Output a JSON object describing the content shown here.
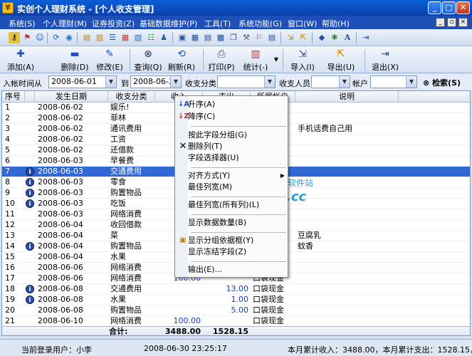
{
  "window": {
    "title": "实创个人理财系统 - [个人收支管理]",
    "app_icon": "coin-icon"
  },
  "menu": [
    {
      "label": "系统(S)"
    },
    {
      "label": "个人理财(M)"
    },
    {
      "label": "证券投资(Z)"
    },
    {
      "label": "基础数据维护(P)"
    },
    {
      "label": "工具(T)"
    },
    {
      "label": "系统功能(G)"
    },
    {
      "label": "窗口(W)"
    },
    {
      "label": "帮助(H)"
    }
  ],
  "toolbar": [
    {
      "label": "添加(A)",
      "icon": "plus-icon"
    },
    {
      "label": "删除(D)",
      "icon": "minus-icon"
    },
    {
      "label": "修改(E)",
      "icon": "pen-icon"
    },
    {
      "label": "查询(Q)",
      "icon": "binoculars-icon"
    },
    {
      "label": "刷新(R)",
      "icon": "refresh-icon"
    },
    {
      "label": "打印(P)",
      "icon": "printer-icon"
    },
    {
      "label": "统计(-)",
      "icon": "chart-icon"
    },
    {
      "label": "导入(I)",
      "icon": "import-icon"
    },
    {
      "label": "导出(U)",
      "icon": "export-icon"
    },
    {
      "label": "退出(X)",
      "icon": "exit-icon"
    }
  ],
  "filter": {
    "date_label": "入帐时间从",
    "date_from": "2008-06-01",
    "to_label": "到",
    "date_to": "2008-06-30",
    "category_label": "收支分类",
    "category_value": "",
    "person_label": "收支人员",
    "person_value": "",
    "account_label": "帐户",
    "account_value": "",
    "search_label": "检索(S)"
  },
  "columns": [
    "序号",
    "发生日期",
    "收支分类",
    "收入",
    "支出",
    "所属帐户",
    "说明"
  ],
  "rows": [
    {
      "no": "1",
      "date": "2008-06-02",
      "category": "娱乐!",
      "income": "",
      "expense": "",
      "account": "",
      "note": "",
      "info": false
    },
    {
      "no": "2",
      "date": "2008-06-02",
      "category": "菲林",
      "income": "",
      "expense": "",
      "account": "",
      "note": "",
      "info": false
    },
    {
      "no": "3",
      "date": "2008-06-02",
      "category": "通讯费用",
      "income": "",
      "expense": "",
      "account": "",
      "note": "手机话费自己用",
      "info": false
    },
    {
      "no": "4",
      "date": "2008-06-02",
      "category": "工资",
      "income": "2",
      "expense": "",
      "account": "",
      "note": "",
      "info": false
    },
    {
      "no": "5",
      "date": "2008-06-02",
      "category": "还借款",
      "income": "",
      "expense": "",
      "account": "",
      "note": "",
      "info": false
    },
    {
      "no": "6",
      "date": "2008-06-03",
      "category": "早餐费",
      "income": "",
      "expense": "",
      "account": "",
      "note": "",
      "info": false
    },
    {
      "no": "7",
      "date": "2008-06-03",
      "category": "交通费用",
      "income": "",
      "expense": "",
      "account": "",
      "note": "",
      "info": true
    },
    {
      "no": "8",
      "date": "2008-06-03",
      "category": "零食",
      "income": "",
      "expense": "",
      "account": "",
      "note": "",
      "info": true
    },
    {
      "no": "9",
      "date": "2008-06-03",
      "category": "购置物品",
      "income": "",
      "expense": "",
      "account": "",
      "note": "",
      "info": true
    },
    {
      "no": "10",
      "date": "2008-06-03",
      "category": "吃饭",
      "income": "",
      "expense": "",
      "account": "",
      "note": "",
      "info": true
    },
    {
      "no": "11",
      "date": "2008-06-03",
      "category": "网络消费",
      "income": "",
      "expense": "",
      "account": "",
      "note": "",
      "info": false
    },
    {
      "no": "12",
      "date": "2008-06-04",
      "category": "收回借款",
      "income": "",
      "expense": "",
      "account": "",
      "note": "",
      "info": false
    },
    {
      "no": "13",
      "date": "2008-06-04",
      "category": "菜",
      "income": "",
      "expense": "",
      "account": "",
      "note": "豆腐乳",
      "info": false
    },
    {
      "no": "14",
      "date": "2008-06-04",
      "category": "购置物品",
      "income": "",
      "expense": "",
      "account": "",
      "note": "蚊香",
      "info": true
    },
    {
      "no": "15",
      "date": "2008-06-04",
      "category": "水果",
      "income": "",
      "expense": "",
      "account": "",
      "note": "",
      "info": false
    },
    {
      "no": "16",
      "date": "2008-06-06",
      "category": "网络消费",
      "income": "",
      "expense": "",
      "account": "",
      "note": "",
      "info": false
    },
    {
      "no": "17",
      "date": "2008-06-06",
      "category": "网络消费",
      "income": "100.00",
      "expense": "",
      "account": "口袋现金",
      "note": "",
      "info": false
    },
    {
      "no": "18",
      "date": "2008-06-08",
      "category": "交通费用",
      "income": "",
      "expense": "13.00",
      "account": "口袋现金",
      "note": "",
      "info": true
    },
    {
      "no": "19",
      "date": "2008-06-08",
      "category": "水果",
      "income": "",
      "expense": "1.00",
      "account": "口袋现金",
      "note": "",
      "info": true
    },
    {
      "no": "20",
      "date": "2008-06-08",
      "category": "购置物品",
      "income": "",
      "expense": "5.00",
      "account": "口袋现金",
      "note": "",
      "info": false
    },
    {
      "no": "21",
      "date": "2008-06-10",
      "category": "网络消费",
      "income": "100.00",
      "expense": "",
      "account": "口袋现金",
      "note": "",
      "info": false
    }
  ],
  "selected_row": 7,
  "totals": {
    "label": "合计:",
    "income": "3488.00",
    "expense": "1528.15"
  },
  "context_menu": [
    {
      "label": "升序(A)",
      "icon": "sort-asc-icon"
    },
    {
      "label": "降序(C)",
      "icon": "sort-desc-icon"
    },
    {
      "label": "按此字段分组(G)",
      "icon": ""
    },
    {
      "label": "删除列(T)",
      "icon": "delete-column-icon"
    },
    {
      "label": "字段选择器(U)",
      "icon": ""
    },
    {
      "label": "对齐方式(Y)",
      "icon": "",
      "submenu": true
    },
    {
      "label": "最佳列宽(M)",
      "icon": ""
    },
    {
      "label": "最佳列宽(所有列)(L)",
      "icon": ""
    },
    {
      "label": "显示数据数量(B)",
      "icon": ""
    },
    {
      "label": "显示分组依据框(Y)",
      "icon": "group-box-icon"
    },
    {
      "label": "显示冻结字段(Z)",
      "icon": ""
    },
    {
      "label": "输出(E)...",
      "icon": ""
    }
  ],
  "status": {
    "user": "当前登录用户：小李",
    "time": "2008-06-30 23:25:17",
    "month_income": "本月累计收入：3488.00，本月累计支出：1528.15，差"
  },
  "watermark": {
    "text": "3322",
    "suffix": ".cc",
    "site": "软件站"
  }
}
